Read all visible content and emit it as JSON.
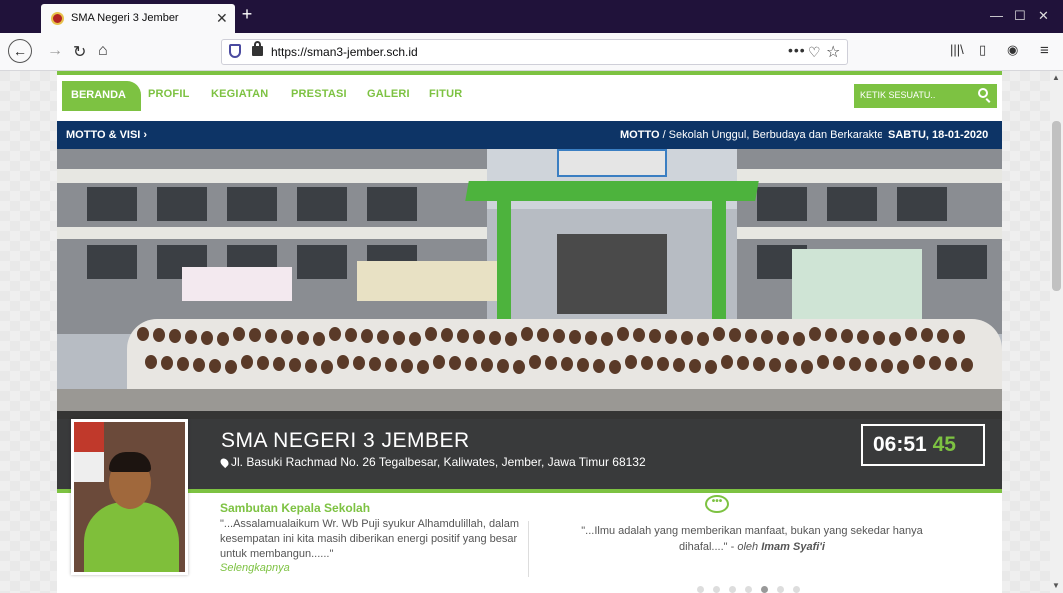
{
  "browser": {
    "tab_title": "SMA Negeri 3 Jember",
    "url": "https://sman3-jember.sch.id"
  },
  "nav": {
    "active": "BERANDA",
    "items": [
      "PROFIL",
      "KEGIATAN",
      "PRESTASI",
      "GALERI",
      "FITUR"
    ],
    "search_placeholder": "KETIK SESUATU.."
  },
  "ticker": {
    "left": "MOTTO & VISI ›",
    "motto_label": "MOTTO",
    "motto_text": " / Sekolah Unggul, Berbudaya dan Berkarakter",
    "date": "SABTU, 18-01-2020"
  },
  "hero": {
    "school_name": "SMA NEGERI 3 JEMBER",
    "address": "Jl. Basuki Rachmad No. 26 Tegalbesar, Kaliwates, Jember, Jawa Timur 68132",
    "clock_hm": "06:51",
    "clock_sec": "45"
  },
  "welcome": {
    "heading": "Sambutan Kepala Sekolah",
    "text": "\"...Assalamualaikum Wr. Wb Puji syukur Alhamdulillah, dalam kesempatan ini kita masih diberikan energi positif yang besar untuk membangun......\"",
    "more": "Selengkapnya"
  },
  "quote": {
    "text": "\"...Ilmu adalah yang memberikan manfaat, bukan yang sekedar hanya dihafal....\" - ",
    "by_prefix": "oleh ",
    "author": "Imam Syafi'i",
    "slides": 7,
    "active_slide": 5
  },
  "colors": {
    "accent": "#7dc242",
    "navy": "#0d3466"
  }
}
